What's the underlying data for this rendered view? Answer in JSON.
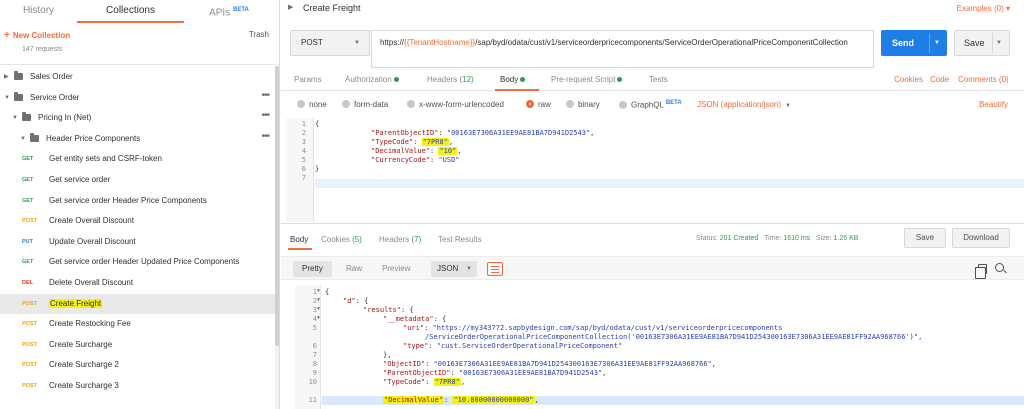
{
  "sidebar": {
    "tabs": [
      {
        "label": "History"
      },
      {
        "label": "Collections"
      },
      {
        "label": "APIs",
        "badge": "BETA"
      }
    ],
    "new_collection": "New Collection",
    "trash": "Trash",
    "request_count": "147 requests",
    "tree": [
      {
        "type": "folder",
        "label": "Sales Order",
        "level": 0,
        "expanded": false
      },
      {
        "type": "folder",
        "label": "Service Order",
        "level": 0,
        "expanded": true
      },
      {
        "type": "folder",
        "label": "Pricing In (Net)",
        "level": 1,
        "expanded": true
      },
      {
        "type": "folder",
        "label": "Header Price Components",
        "level": 2,
        "expanded": true
      },
      {
        "type": "request",
        "method": "GET",
        "label": "Get entity sets and CSRF-token"
      },
      {
        "type": "request",
        "method": "GET",
        "label": "Get service order"
      },
      {
        "type": "request",
        "method": "GET",
        "label": "Get service order Header Price Components"
      },
      {
        "type": "request",
        "method": "POST",
        "label": "Create Overall Discount"
      },
      {
        "type": "request",
        "method": "PUT",
        "label": "Update Overall Discount"
      },
      {
        "type": "request",
        "method": "GET",
        "label": "Get service order Header Updated Price Components"
      },
      {
        "type": "request",
        "method": "DEL",
        "label": "Delete Overall Discount"
      },
      {
        "type": "request",
        "method": "POST",
        "label": "Create Freight",
        "selected": true
      },
      {
        "type": "request",
        "method": "POST",
        "label": "Create Restocking Fee"
      },
      {
        "type": "request",
        "method": "POST",
        "label": "Create Surcharge"
      },
      {
        "type": "request",
        "method": "POST",
        "label": "Create Surcharge 2"
      },
      {
        "type": "request",
        "method": "POST",
        "label": "Create Surcharge 3"
      }
    ]
  },
  "request": {
    "title": "Create Freight",
    "examples": "Examples (0)",
    "method": "POST",
    "url_prefix": "https://",
    "url_var": "{{TenantHostname}}",
    "url_rest": "/sap/byd/odata/cust/v1/serviceorderpricecomponents/ServiceOrderOperationalPriceComponentCollection",
    "send": "Send",
    "save": "Save",
    "tabs": {
      "params": "Params",
      "authorization": "Authorization",
      "headers": "Headers",
      "headers_count": "(12)",
      "body": "Body",
      "prerequest": "Pre-request Script",
      "tests": "Tests"
    },
    "links": {
      "cookies": "Cookies",
      "code": "Code",
      "comments": "Comments (0)"
    },
    "body_modes": {
      "none": "none",
      "form_data": "form-data",
      "urlencoded": "x-www-form-urlencoded",
      "raw": "raw",
      "binary": "binary",
      "graphql": "GraphQL",
      "graphql_badge": "BETA"
    },
    "content_type": "JSON (application/json)",
    "beautify": "Beautify",
    "body_lines": {
      "l1": "{",
      "l2_key": "\"ParentObjectID\"",
      "l2_val": "\"00163E7306A31EE9AE81BA7D941D2543\"",
      "l3_key": "\"TypeCode\"",
      "l3_val": "\"7PR8\"",
      "l4_key": "\"DecimalValue\"",
      "l4_val": "\"10\"",
      "l5_key": "\"CurrencyCode\"",
      "l5_val": "\"USD\"",
      "l6": "}"
    },
    "line_numbers": [
      "1",
      "2",
      "3",
      "4",
      "5",
      "6",
      "7"
    ]
  },
  "response": {
    "tabs": {
      "body": "Body",
      "cookies": "Cookies",
      "cookies_count": "(5)",
      "headers": "Headers",
      "headers_count": "(7)",
      "test_results": "Test Results"
    },
    "status_label": "Status:",
    "status": "201 Created",
    "time_label": "Time:",
    "time": "1610 ms",
    "size_label": "Size:",
    "size": "1.25 KB",
    "save": "Save",
    "download": "Download",
    "views": {
      "pretty": "Pretty",
      "raw": "Raw",
      "preview": "Preview"
    },
    "format": "JSON",
    "line_numbers": [
      "1",
      "2",
      "3",
      "4",
      "5",
      "",
      "6",
      "7",
      "8",
      "9",
      "10",
      "11"
    ],
    "body_lines": {
      "l1": "{",
      "l2_key": "\"d\"",
      "l2_rest": ": {",
      "l3_key": "\"results\"",
      "l3_rest": ": {",
      "l4_key": "\"__metadata\"",
      "l4_rest": ": {",
      "l5_key": "\"uri\"",
      "l5_val": "\"https://my343772.sapbydesign.com/sap/byd/odata/cust/v1/serviceorderpricecomponents",
      "l5b_val": "/ServiceOrderOperationalPriceComponentCollection('00163E7306A31EE9AE81BA7D941D254300163E7306A31EE9AE81FF92AA968766')\",",
      "l6_key": "\"type\"",
      "l6_val": "\"cust.ServiceOrderOperationalPriceComponent\"",
      "l7": "},",
      "l8_key": "\"ObjectID\"",
      "l8_val": "\"00163E7306A31EE9AE81BA7D941D254300163E7306A31EE9AE81FF92AA968766\"",
      "l9_key": "\"ParentObjectID\"",
      "l9_val": "\"00163E7306A31EE9AE81BA7D941D2543\"",
      "l10_key": "\"TypeCode\"",
      "l10_val": "\"7PR8\"",
      "l11_key": "\"DecimalValue\"",
      "l11_val": "\"10.00000000000000\""
    }
  },
  "colors": {
    "accent": "#f26b3a",
    "send": "#1f7ee5",
    "get": "#2d9d4e",
    "post": "#e8a317",
    "put": "#2d7fe0",
    "del": "#d9352b",
    "highlight": "#f5f116"
  }
}
